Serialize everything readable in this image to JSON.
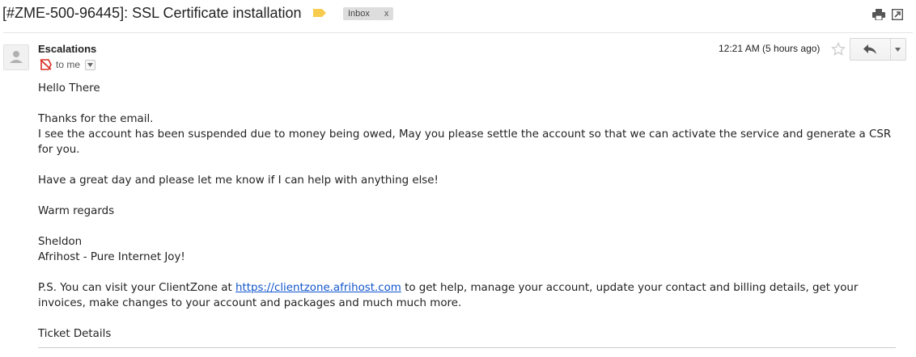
{
  "email": {
    "subject": "[#ZME-500-96445]: SSL Certificate installation",
    "label": "Inbox",
    "label_close": "x",
    "sender": "Escalations",
    "recipient": "to me",
    "timestamp": "12:21 AM (5 hours ago)"
  },
  "body": {
    "greeting": "Hello There",
    "line1": "Thanks for the email.",
    "line2": "I see the account has been suspended due to money being owed, May you please settle the account so that we can activate the service and generate a CSR for you.",
    "line3": "Have a great day and please let me know if I can help with anything else!",
    "closing": "Warm regards",
    "signature_name": "Sheldon",
    "signature_company": "Afrihost - Pure Internet Joy!",
    "ps_prefix": "P.S. You can visit your ClientZone at ",
    "ps_link": "https://clientzone.afrihost.com",
    "ps_suffix": " to get help, manage your account, update your contact and billing details, get your invoices, make changes to your account and packages and much much more.",
    "ticket_details": "Ticket Details"
  },
  "icons": {
    "label_tag": "label-tag-icon",
    "print": "print-icon",
    "new_window": "new-window-icon",
    "avatar": "avatar-icon",
    "importance": "importance-icon",
    "star": "star-icon",
    "reply": "reply-icon",
    "more": "chevron-down-icon"
  },
  "colors": {
    "label_tag": "#f7cb4d",
    "chip_bg": "#dddddd",
    "link": "#1155cc",
    "importance": "#d93025"
  }
}
